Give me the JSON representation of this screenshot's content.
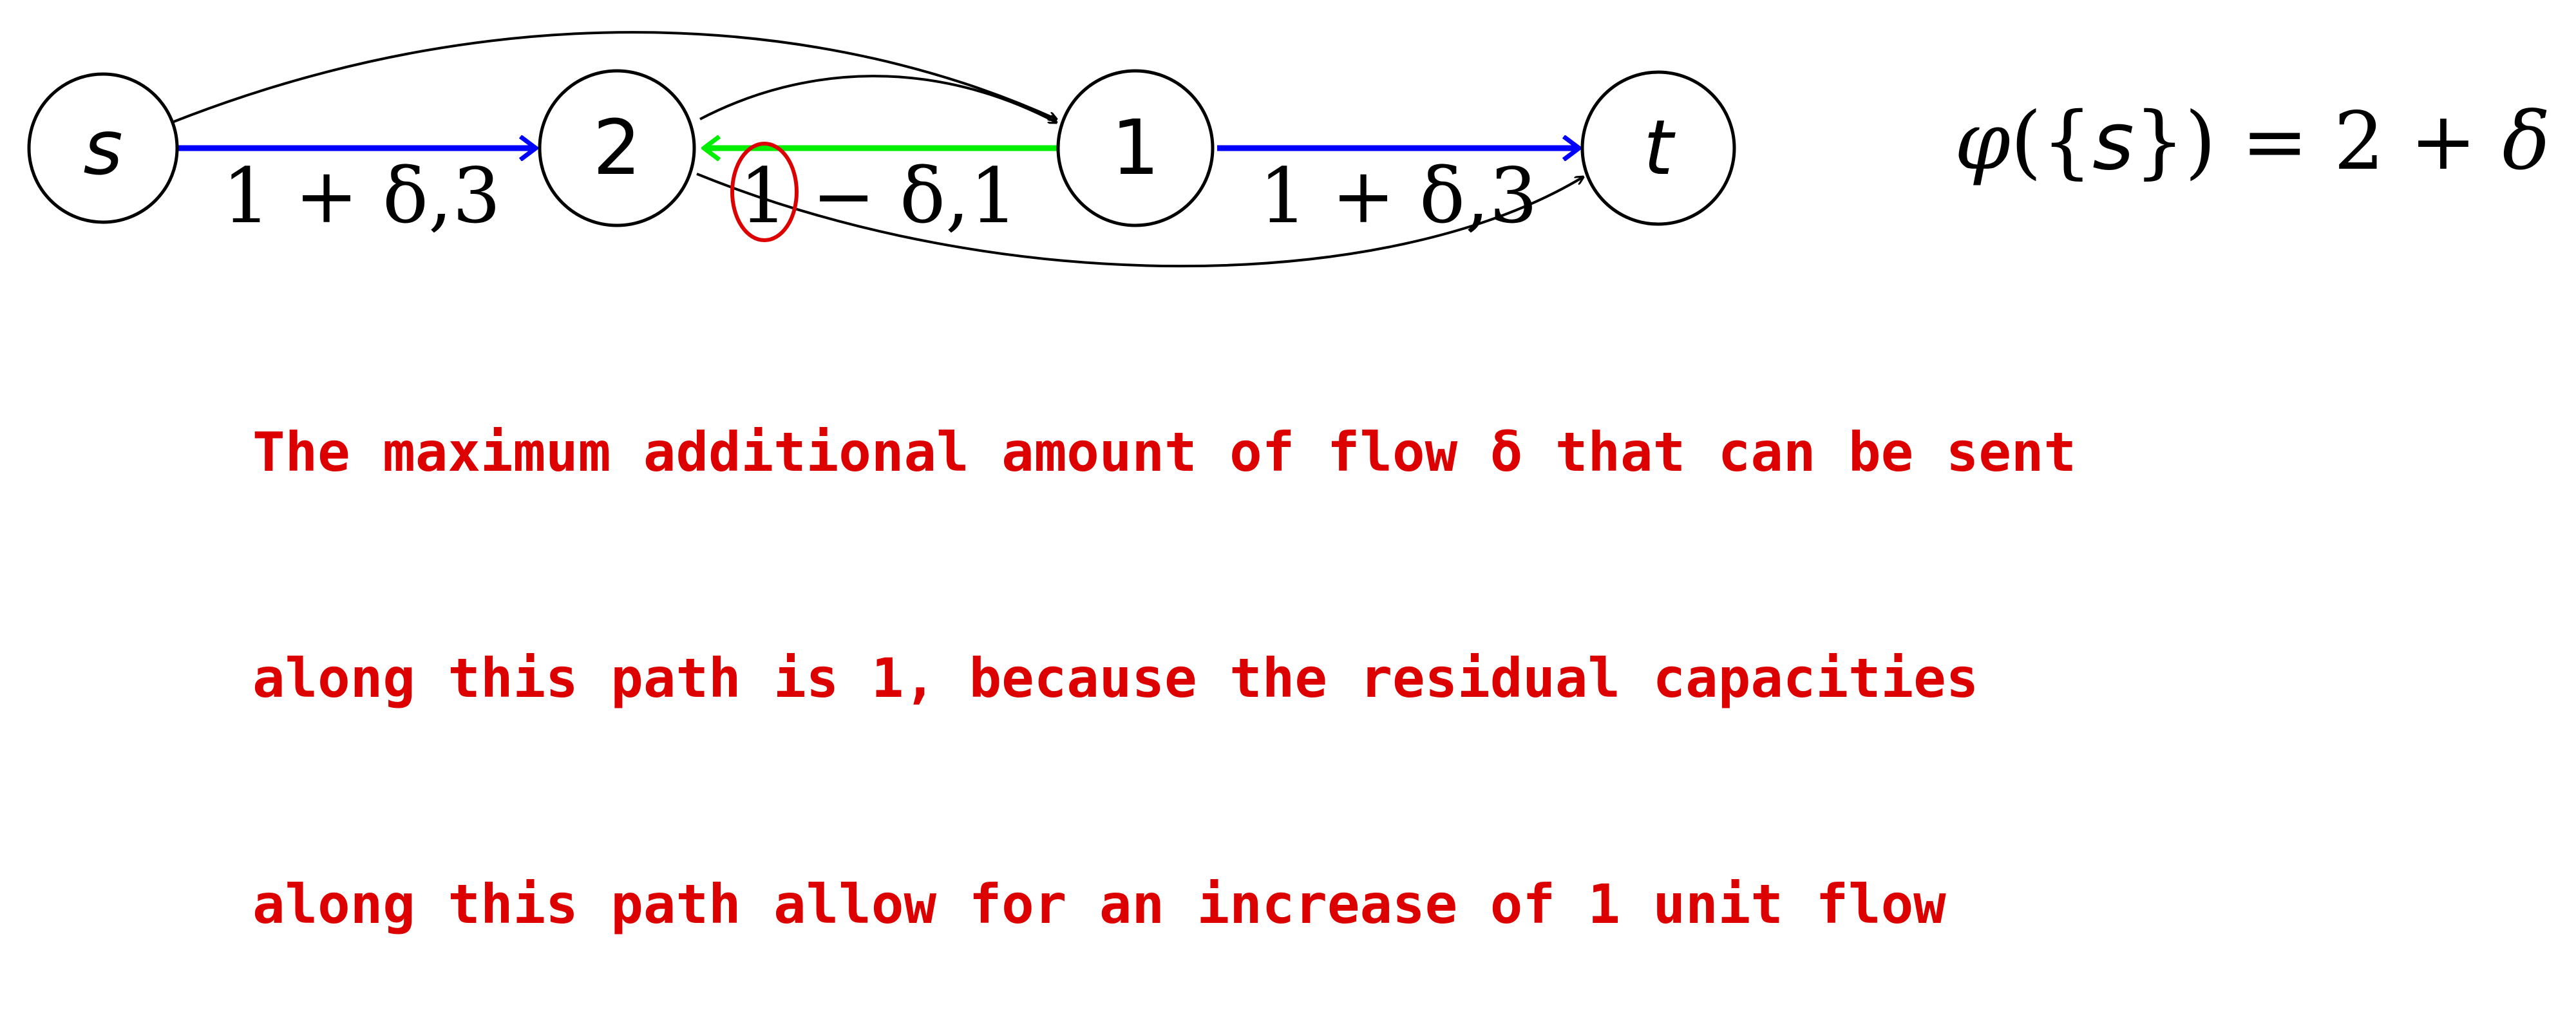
{
  "nodes": {
    "s": "s",
    "n2": "2",
    "n1": "1",
    "t": "t"
  },
  "edge_labels": {
    "s_2": "1 + δ,3",
    "n1_n2": "1 − δ,1",
    "n1_t": "1 + δ,3"
  },
  "formula": {
    "phi": "φ",
    "open": "({",
    "set": "s",
    "close": "})",
    "rhs": " = 2 + ",
    "delta": "δ"
  },
  "note_lines": [
    "The maximum additional amount of flow δ that can be sent",
    "along this path is 1, because the residual capacities",
    "along this path allow for an increase of 1 unit flow"
  ],
  "colors": {
    "forward_path": "#0000ff",
    "reverse_path": "#00ee00",
    "highlight": "#dd0000",
    "note_text": "#dd0000",
    "curved_edges": "#000000"
  }
}
